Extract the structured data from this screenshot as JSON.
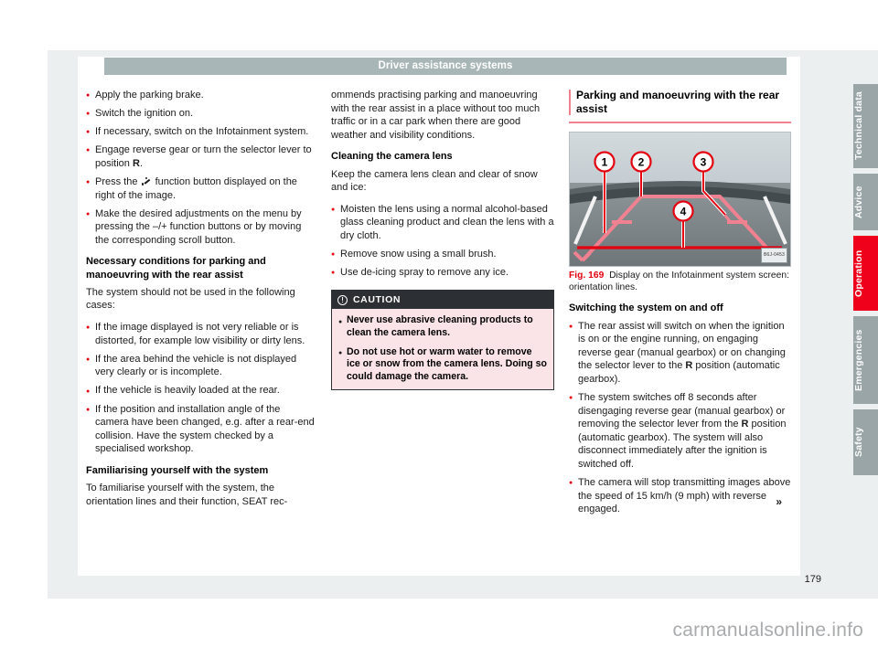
{
  "header": {
    "title": "Driver assistance systems"
  },
  "page_number": "179",
  "watermark": "carmanualsonline.info",
  "continuation_marker": "»",
  "colors": {
    "accent_red": "#e3000f",
    "tab_active": "#ef001b",
    "tab_inactive": "#9aa5a7",
    "header_bar": "#a9b6b8",
    "caution_bg": "#fbe4e8",
    "caution_head": "#2c2f33",
    "rule_pink": "#ef8190",
    "page_bg": "#eceff0"
  },
  "column1": {
    "bullets_top": [
      "Apply the parking brake.",
      "Switch the ignition on.",
      "If necessary, switch on the Infotainment system."
    ],
    "bullet_engage_pre": "Engage reverse gear or turn the selector lever to position ",
    "bullet_engage_bold": "R",
    "bullet_engage_post": ".",
    "bullet_press_pre": "Press the ",
    "bullet_press_icon": "function-button-icon",
    "bullet_press_post": " function button displayed on the right of the image.",
    "bullet_adjust": "Make the desired adjustments on the menu by pressing the –/+ function buttons or by moving the corresponding scroll button.",
    "heading_conditions": "Necessary conditions for parking and manoeuvring with the rear assist",
    "conditions_intro": "The system should not be used in the following cases:",
    "conditions_bullets": [
      "If the image displayed is not very reliable or is distorted, for example low visibility or dirty lens.",
      "If the area behind the vehicle is not displayed very clearly or is incomplete.",
      "If the vehicle is heavily loaded at the rear.",
      "If the position and installation angle of the camera have been changed, e.g. after a rear-end collision. Have the system checked by a specialised workshop."
    ],
    "heading_familiarising": "Familiarising yourself with the system",
    "familiarising_text": "To familiarise yourself with the system, the orientation lines and their function, SEAT rec-"
  },
  "column2": {
    "continued_text": "ommends practising parking and manoeuvring with the rear assist in a place without too much traffic or in a car park when there are good weather and visibility conditions.",
    "heading_cleaning": "Cleaning the camera lens",
    "cleaning_intro": "Keep the camera lens clean and clear of snow and ice:",
    "cleaning_bullets": [
      "Moisten the lens using a normal alcohol-based glass cleaning product and clean the lens with a dry cloth.",
      "Remove snow using a small brush.",
      "Use de-icing spray to remove any ice."
    ],
    "caution": {
      "title": "CAUTION",
      "icon": "warning-circle-icon",
      "bullets": [
        "Never use abrasive cleaning products to clean the camera lens.",
        "Do not use hot or warm water to remove ice or snow from the camera lens. Doing so could damage the camera."
      ]
    }
  },
  "column3": {
    "section_heading": "Parking and manoeuvring with the rear assist",
    "figure": {
      "code": "B6J-0453",
      "callouts": [
        "1",
        "2",
        "3",
        "4"
      ],
      "caption_label": "Fig. 169",
      "caption_text": "Display on the Infotainment system screen: orientation lines."
    },
    "heading_switching": "Switching the system on and off",
    "switching_bullets": [
      {
        "pre": "The rear assist will switch on when the ignition is on or the engine running, on engaging reverse gear (manual gearbox) or on changing the selector lever to the ",
        "bold": "R",
        "post": " position (automatic gearbox)."
      },
      {
        "pre": "The system switches off 8 seconds after disengaging reverse gear (manual gearbox) or removing the selector lever from the ",
        "bold": "R",
        "post": " position (automatic gearbox). The system will also disconnect immediately after the ignition is switched off."
      },
      {
        "pre": "The camera will stop transmitting images above the speed of 15 km/h (9 mph) with reverse engaged.",
        "bold": "",
        "post": ""
      }
    ]
  },
  "tabs": [
    {
      "label": "Technical data",
      "active": false
    },
    {
      "label": "Advice",
      "active": false
    },
    {
      "label": "Operation",
      "active": true
    },
    {
      "label": "Emergencies",
      "active": false
    },
    {
      "label": "Safety",
      "active": false
    }
  ]
}
